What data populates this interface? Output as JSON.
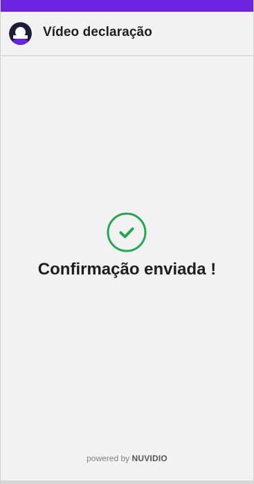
{
  "colors": {
    "accent": "#6c24e0",
    "success": "#1fa84f",
    "avatar_dark": "#1f1b3a"
  },
  "header": {
    "avatar_icon": "user-avatar-icon",
    "title": "Vídeo declaração"
  },
  "main": {
    "status_icon": "check-circle-icon",
    "message": "Confirmação enviada !"
  },
  "footer": {
    "powered_prefix": "powered by",
    "brand": "NUVIDIO"
  }
}
